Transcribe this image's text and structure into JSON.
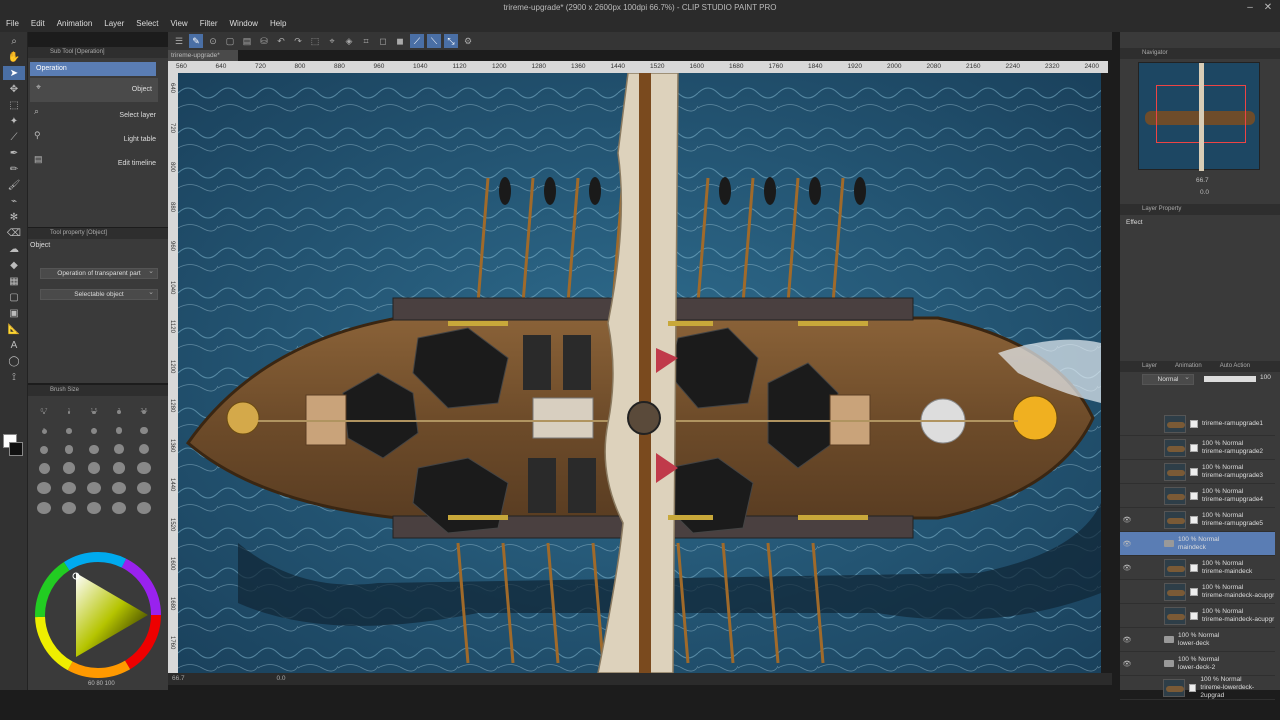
{
  "window": {
    "title": "trireme-upgrade* (2900 x 2600px 100dpi 66.7%) - CLIP STUDIO PAINT PRO"
  },
  "menu": [
    "File",
    "Edit",
    "Animation",
    "Layer",
    "Select",
    "View",
    "Filter",
    "Window",
    "Help"
  ],
  "subtool": {
    "header": "Sub Tool [Operation]",
    "group": "Operation",
    "items": [
      {
        "label": "Object",
        "icon": "object-select-icon"
      },
      {
        "label": "Select layer",
        "icon": "select-layer-icon"
      },
      {
        "label": "Light table",
        "icon": "light-table-icon"
      },
      {
        "label": "Edit timeline",
        "icon": "edit-timeline-icon"
      }
    ]
  },
  "tool_property": {
    "header": "Tool property [Object]",
    "title": "Object",
    "dropdown1": "Operation of transparent part",
    "dropdown2": "Selectable object"
  },
  "brush_size": {
    "header": "Brush Size",
    "sizes": [
      "0.7",
      "1",
      "1.5",
      "2",
      "2.5",
      "3",
      "4",
      "5",
      "6",
      "7",
      "8",
      "10",
      "12",
      "15",
      "17",
      "20",
      "25",
      "30",
      "40",
      "50",
      "60",
      "70",
      "80",
      "100",
      "120",
      "150",
      "170",
      "200",
      "250",
      "300"
    ]
  },
  "color": {
    "bottom_values": "60 80 100"
  },
  "canvas_tab": "trireme-upgrade*",
  "ruler": {
    "h_ticks": [
      "560",
      "640",
      "720",
      "800",
      "880",
      "960",
      "1040",
      "1120",
      "1200",
      "1280",
      "1360",
      "1440",
      "1520",
      "1600",
      "1680",
      "1760",
      "1840",
      "1920",
      "2000",
      "2080",
      "2160",
      "2240",
      "2320",
      "2400"
    ],
    "v_ticks": [
      "640",
      "720",
      "800",
      "880",
      "960",
      "1040",
      "1120",
      "1200",
      "1280",
      "1360",
      "1440",
      "1520",
      "1600",
      "1680",
      "1760"
    ]
  },
  "status": {
    "zoom": "66.7",
    "angle": "0.0"
  },
  "navigator": {
    "header": "Navigator",
    "zoom": "66.7",
    "angle": "0.0"
  },
  "layer_property": {
    "header": "Layer Property",
    "effect": "Effect"
  },
  "layers_panel": {
    "tabs": [
      "Layer",
      "Animation",
      "Auto Action"
    ],
    "blend_mode": "Normal",
    "opacity": "100",
    "layers": [
      {
        "mode": "",
        "name": "trireme-ramupgrade1",
        "type": "raster",
        "visible": false,
        "selected": false,
        "folder": false
      },
      {
        "mode": "100 % Normal",
        "name": "trireme-ramupgrade2",
        "type": "raster",
        "visible": false,
        "selected": false,
        "folder": false
      },
      {
        "mode": "100 % Normal",
        "name": "trireme-ramupgrade3",
        "type": "raster",
        "visible": false,
        "selected": false,
        "folder": false
      },
      {
        "mode": "100 % Normal",
        "name": "trireme-ramupgrade4",
        "type": "raster",
        "visible": false,
        "selected": false,
        "folder": false
      },
      {
        "mode": "100 % Normal",
        "name": "trireme-ramupgrade5",
        "type": "raster",
        "visible": true,
        "selected": false,
        "folder": false
      },
      {
        "mode": "100 % Normal",
        "name": "maindeck",
        "type": "folder",
        "visible": true,
        "selected": true,
        "folder": true
      },
      {
        "mode": "100 % Normal",
        "name": "trireme-maindeck",
        "type": "raster",
        "visible": true,
        "selected": false,
        "folder": false
      },
      {
        "mode": "100 % Normal",
        "name": "trireme-maindeck-acupgr",
        "type": "raster",
        "visible": false,
        "selected": false,
        "folder": false
      },
      {
        "mode": "100 % Normal",
        "name": "trireme-maindeck-acupgr",
        "type": "raster",
        "visible": false,
        "selected": false,
        "folder": false
      },
      {
        "mode": "100 % Normal",
        "name": "lower-deck",
        "type": "folder",
        "visible": true,
        "selected": false,
        "folder": true
      },
      {
        "mode": "100 % Normal",
        "name": "lower-deck-2",
        "type": "folder",
        "visible": true,
        "selected": false,
        "folder": true
      },
      {
        "mode": "100 % Normal",
        "name": "trireme-lowerdeck-2upgrad",
        "type": "raster",
        "visible": false,
        "selected": false,
        "folder": false
      }
    ]
  },
  "colors": {
    "accent": "#5a7db4",
    "panel_bg": "#3a3a3a",
    "sea": "#1d4763",
    "wood": "#7a5a36"
  }
}
